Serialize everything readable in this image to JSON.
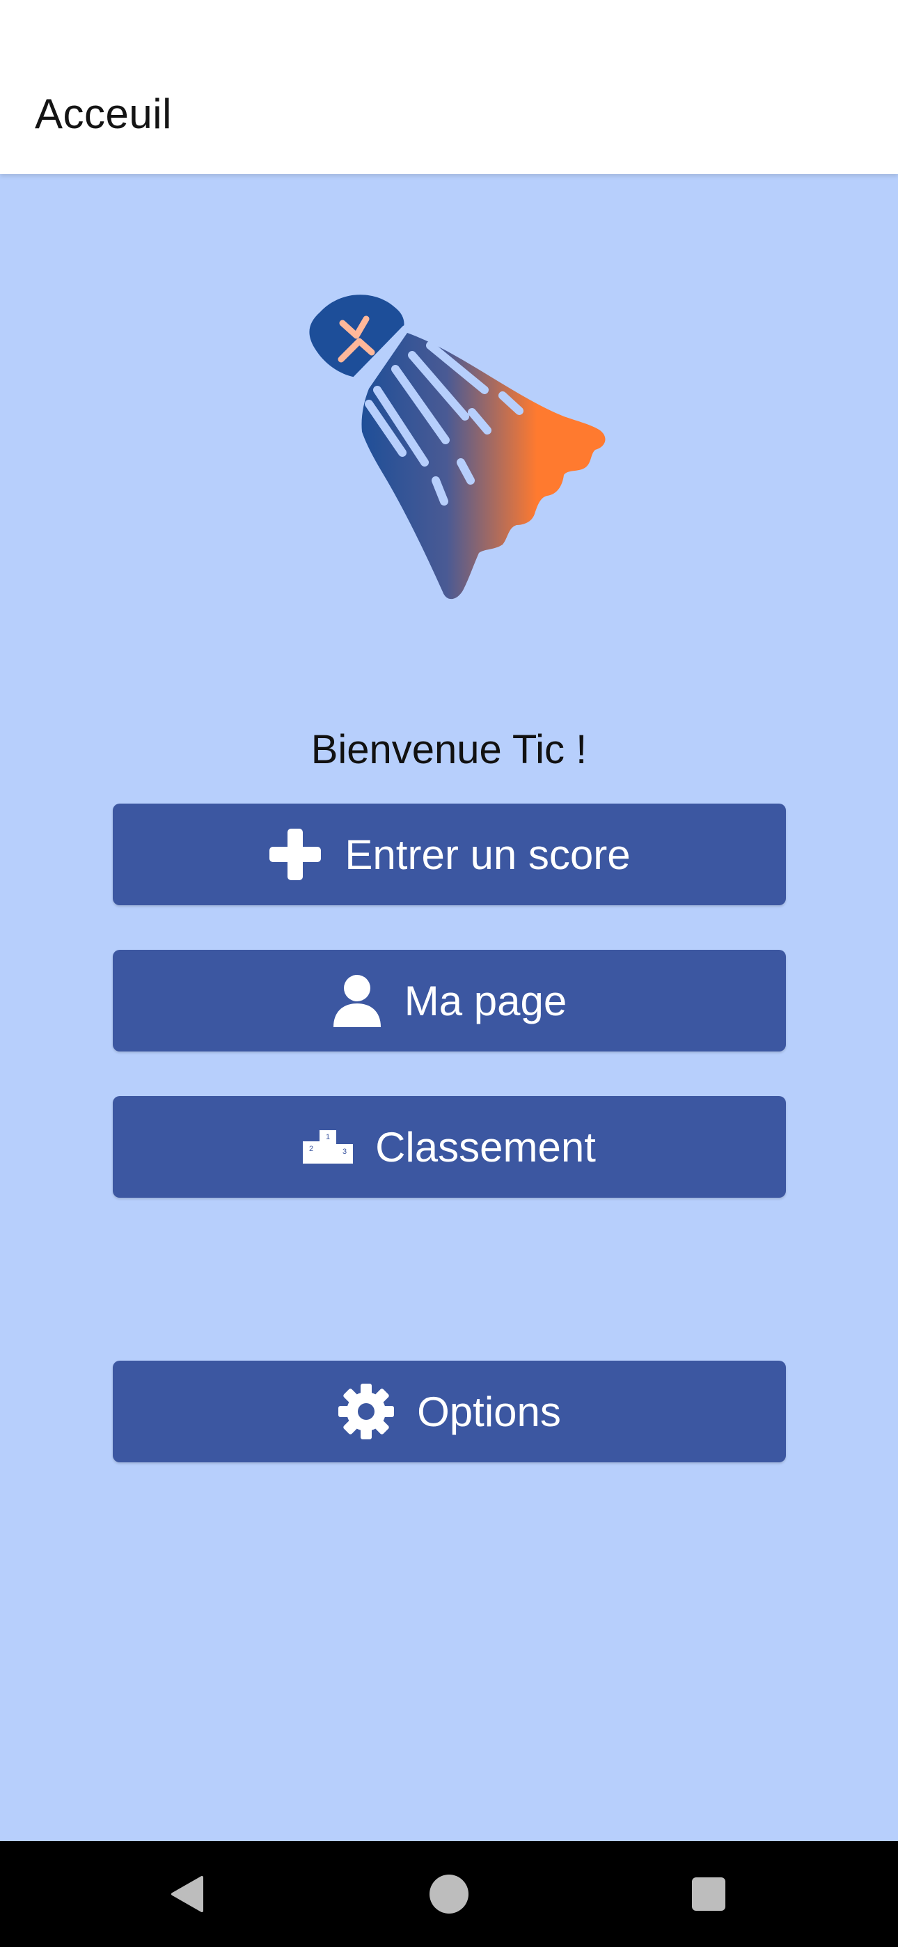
{
  "app_bar": {
    "title": "Acceuil"
  },
  "logo": {
    "icon": "badminton-shuttlecock-logo",
    "gradient_start": "#1f4f98",
    "gradient_end": "#ff7a2f"
  },
  "welcome": {
    "text": "Bienvenue Tic !"
  },
  "buttons": {
    "score": {
      "label": "Entrer un score",
      "icon": "plus-icon"
    },
    "page": {
      "label": "Ma page",
      "icon": "person-icon"
    },
    "ranking": {
      "label": "Classement",
      "icon": "podium-icon",
      "podium_labels": [
        "1",
        "2",
        "3"
      ]
    },
    "options": {
      "label": "Options",
      "icon": "gear-icon"
    }
  },
  "nav_bar": {
    "items": [
      "back-icon",
      "home-icon",
      "recent-apps-icon"
    ]
  },
  "colors": {
    "background": "#b7cffc",
    "button": "#3c57a1",
    "app_bar": "#ffffff",
    "nav_bar": "#000000"
  }
}
